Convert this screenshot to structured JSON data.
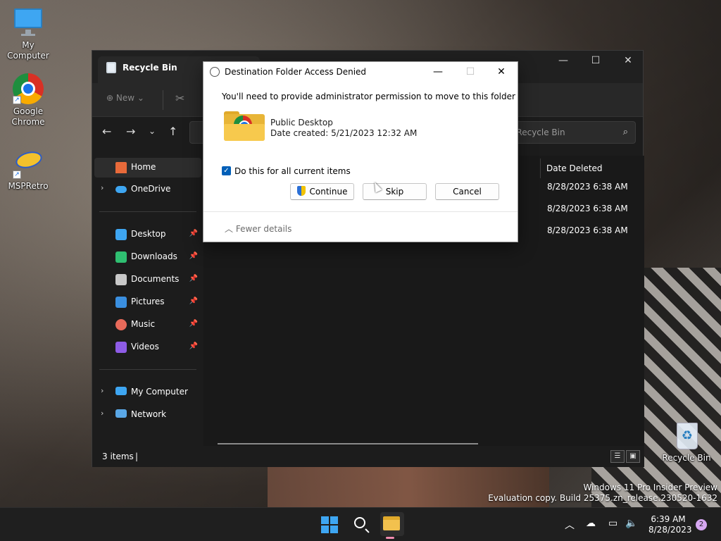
{
  "desktop": {
    "icons": [
      {
        "label": "My Computer"
      },
      {
        "label": "Google Chrome"
      },
      {
        "label": "MSPRetro"
      },
      {
        "label": "Recycle Bin"
      }
    ],
    "watermark": {
      "line1": "Windows 11 Pro Insider Preview",
      "line2": "Evaluation copy. Build 25375.zn_release.230520-1632"
    }
  },
  "explorer": {
    "tab_title": "Recycle Bin",
    "toolbar": {
      "new_label": "New"
    },
    "search_placeholder": "h Recycle Bin",
    "sidebar": {
      "home": "Home",
      "onedrive": "OneDrive",
      "pinned": [
        {
          "label": "Desktop",
          "icon": "desktop-icon",
          "color": "#3ea6f2"
        },
        {
          "label": "Downloads",
          "icon": "download-icon",
          "color": "#2fbf71"
        },
        {
          "label": "Documents",
          "icon": "document-icon",
          "color": "#c8c8c8"
        },
        {
          "label": "Pictures",
          "icon": "picture-icon",
          "color": "#3a8fe0"
        },
        {
          "label": "Music",
          "icon": "music-icon",
          "color": "#e86a5a"
        },
        {
          "label": "Videos",
          "icon": "video-icon",
          "color": "#8e5ce6"
        }
      ],
      "my_computer": "My Computer",
      "network": "Network"
    },
    "columns": {
      "date_deleted": "Date Deleted"
    },
    "rows": [
      {
        "date_deleted": "8/28/2023 6:38 AM"
      },
      {
        "date_deleted": "8/28/2023 6:38 AM"
      },
      {
        "date_deleted": "8/28/2023 6:38 AM"
      }
    ],
    "status": {
      "items_count": "3 items"
    }
  },
  "dialog": {
    "title": "Destination Folder Access Denied",
    "message": "You'll need to provide administrator permission to move to this folder",
    "item_name": "Public Desktop",
    "item_date": "Date created: 5/21/2023 12:32 AM",
    "checkbox_label": "Do this for all current items",
    "checkbox_checked": true,
    "buttons": {
      "continue": "Continue",
      "skip": "Skip",
      "cancel": "Cancel"
    },
    "fewer_details": "Fewer details"
  },
  "taskbar": {
    "time": "6:39 AM",
    "date": "8/28/2023",
    "notification_count": "2"
  }
}
